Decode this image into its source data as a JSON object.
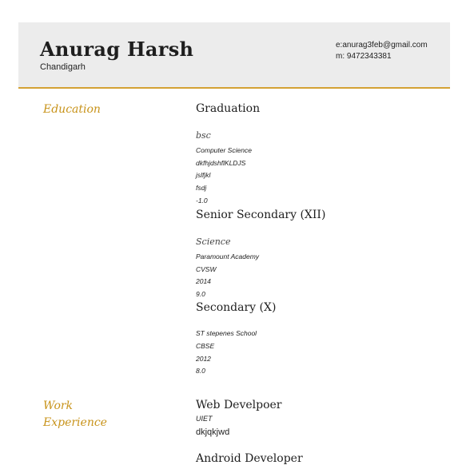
{
  "header": {
    "name": "Anurag Harsh",
    "city": "Chandigarh",
    "email": "e:anurag3feb@gmail.com",
    "phone": "m: 9472343381"
  },
  "education": {
    "section_title": "Education",
    "entries": [
      {
        "title": "Graduation",
        "subtitle": "bsc",
        "details": [
          "Computer Science",
          "dkfhjdshflKLDJS",
          "jslfjkl",
          "fsdj",
          "-1.0"
        ]
      },
      {
        "title": "Senior Secondary (XII)",
        "subtitle": "Science",
        "details": [
          "Paramount Academy",
          "CVSW",
          "2014",
          "9.0"
        ]
      },
      {
        "title": "Secondary (X)",
        "details": [
          "ST stepenes School",
          "CBSE",
          "2012",
          "8.0"
        ]
      }
    ]
  },
  "work": {
    "section_title_line1": "Work",
    "section_title_line2": "Experience",
    "entries": [
      {
        "title": "Web Develpoer",
        "org": "UIET",
        "description": "dkjqkjwd"
      },
      {
        "title": "Android Developer"
      }
    ]
  },
  "colors": {
    "accent": "#c8931a",
    "header_bg": "#ececec",
    "header_rule": "#d4a134"
  }
}
